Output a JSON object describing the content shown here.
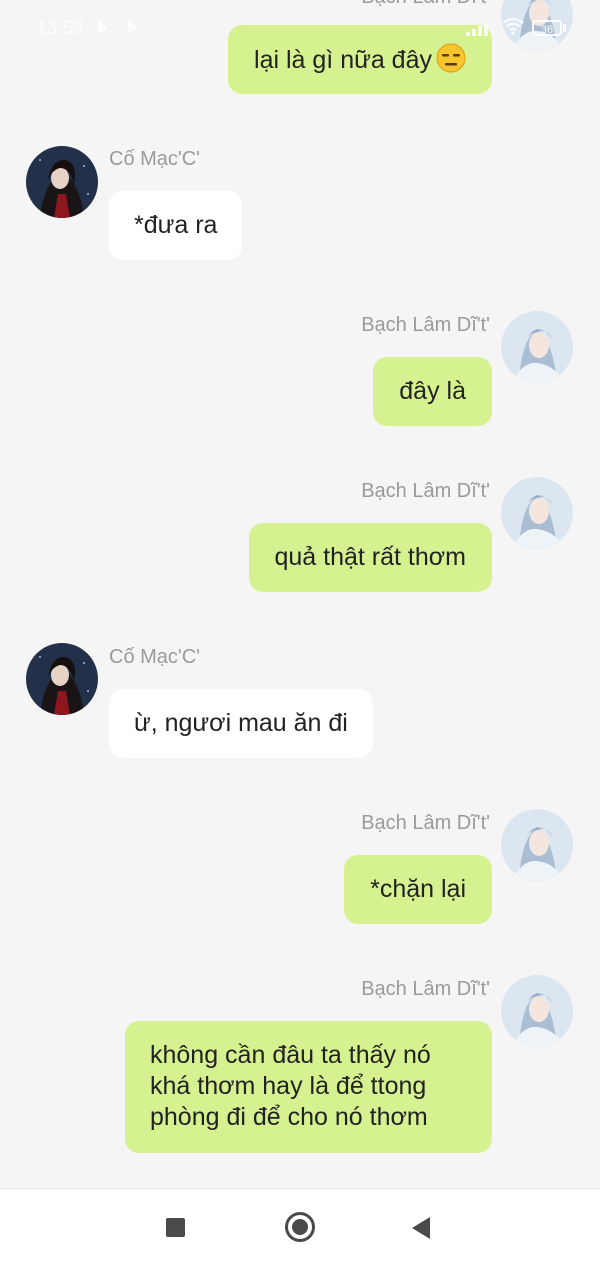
{
  "status_bar": {
    "time": "13:53",
    "battery": "36"
  },
  "messages": [
    {
      "sender": "Bạch Lâm Dĩ't'",
      "side": "right",
      "text": "lại là gì nữa đây",
      "emoji": "expressionless-face"
    },
    {
      "sender": "Cố Mạc'C'",
      "side": "left",
      "text": "*đưa ra"
    },
    {
      "sender": "Bạch Lâm Dĩ't'",
      "side": "right",
      "text": "đây là"
    },
    {
      "sender": "Bạch Lâm Dĩ't'",
      "side": "right",
      "text": "quả thật rất thơm"
    },
    {
      "sender": "Cố Mạc'C'",
      "side": "left",
      "text": "ừ, ngươi mau ăn đi"
    },
    {
      "sender": "Bạch Lâm Dĩ't'",
      "side": "right",
      "text": "*chặn lại"
    },
    {
      "sender": "Bạch Lâm Dĩ't'",
      "side": "right",
      "text_lines": [
        "không cần đâu ta thấy nó",
        "khá thơm hay là để ttong",
        "phòng đi để cho nó thơm"
      ]
    }
  ],
  "colors": {
    "background": "#f5f5f5",
    "own_bubble": "#d6f18f",
    "other_bubble": "#ffffff",
    "sender_name": "#9a9a9a"
  },
  "icons": {
    "nav": [
      "recents-square-icon",
      "home-circle-icon",
      "back-triangle-icon"
    ],
    "status": [
      "play-icon",
      "signal-icon",
      "wifi-icon",
      "battery-icon"
    ]
  }
}
